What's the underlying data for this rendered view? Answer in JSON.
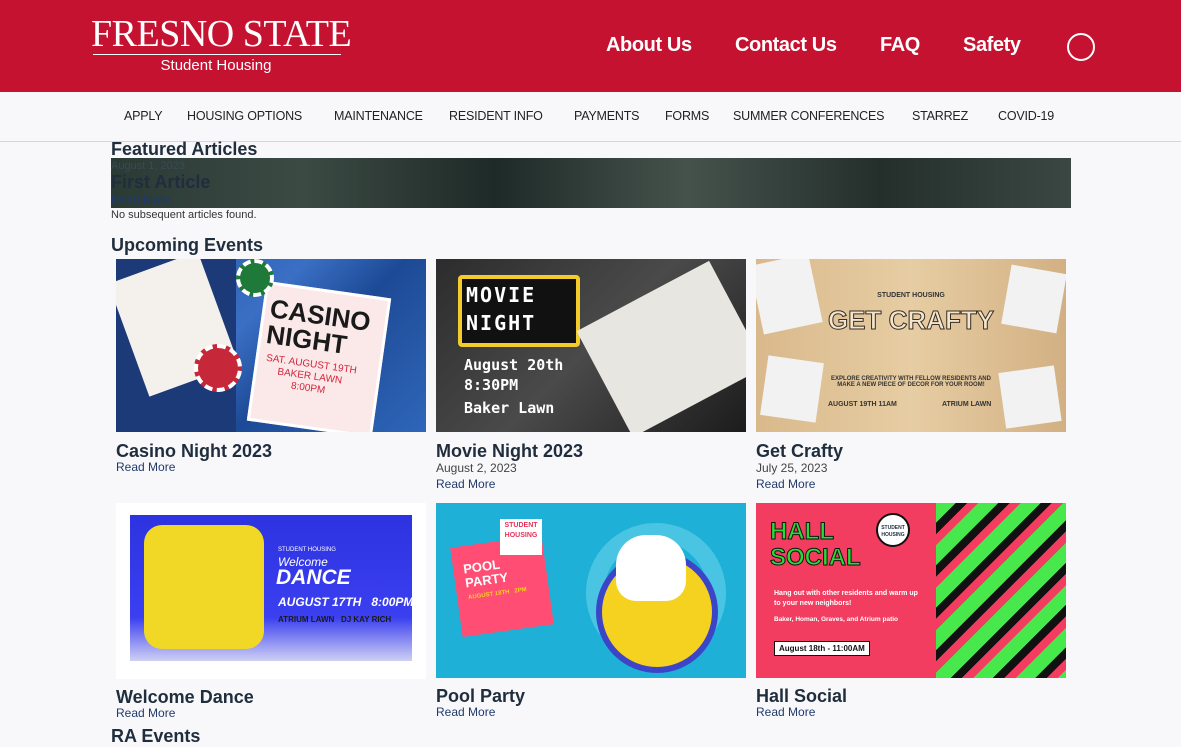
{
  "header": {
    "logo_text": "FRESNO STATE",
    "logo_sub": "Student Housing",
    "nav": [
      "About Us",
      "Contact Us",
      "FAQ",
      "Safety"
    ],
    "search_icon": "search-icon"
  },
  "subnav": [
    "APPLY",
    "HOUSING OPTIONS",
    "MAINTENANCE",
    "RESIDENT INFO",
    "PAYMENTS",
    "FORMS",
    "SUMMER CONFERENCES",
    "STARREZ",
    "COVID-19"
  ],
  "featured": {
    "heading": "Featured Articles",
    "article_title": "First Article",
    "article_date": "August 1, 2023",
    "read_more": "Read More",
    "none_text": "No subsequent articles found."
  },
  "events": {
    "heading": "Upcoming Events",
    "items": [
      {
        "title": "Casino Night 2023",
        "date": "",
        "read_more": "Read More",
        "poster": {
          "line1": "CASINO",
          "line2": "NIGHT",
          "line3": "SAT. AUGUST 19TH",
          "line4": "BAKER LAWN",
          "line5": "8:00PM"
        }
      },
      {
        "title": "Movie Night 2023",
        "date": "August 2, 2023",
        "read_more": "Read More",
        "poster": {
          "line1": "MOVIE",
          "line2": "NIGHT",
          "line3": "August 20th",
          "line4": "8:30PM",
          "line5": "Baker Lawn"
        }
      },
      {
        "title": "Get Crafty",
        "date": "July 25, 2023",
        "read_more": "Read More",
        "poster": {
          "line1": "STUDENT HOUSING",
          "line2": "GET CRAFTY",
          "line3": "EXPLORE CREATIVITY WITH FELLOW RESIDENTS AND MAKE A NEW PIECE OF DECOR FOR YOUR ROOM!",
          "line4": "AUGUST 19TH 11AM",
          "line5": "ATRIUM LAWN"
        }
      },
      {
        "title": "Welcome Dance",
        "date": "",
        "read_more": "Read More",
        "poster": {
          "line1": "STUDENT HOUSING",
          "line2": "Welcome",
          "line3": "DANCE",
          "line4": "AUGUST 17TH   8:00PM",
          "line5": "ATRIUM LAWN   DJ KAY RICH"
        }
      },
      {
        "title": "Pool Party",
        "date": "",
        "read_more": "Read More",
        "poster": {
          "line1": "STUDENT HOUSING",
          "line2": "POOL PARTY",
          "line3": "AUGUST 18TH   2PM"
        }
      },
      {
        "title": "Hall Social",
        "date": "",
        "read_more": "Read More",
        "poster": {
          "line1": "HALL SOCIAL",
          "line2": "Hang out with other residents and warm up to your new neighbors!",
          "line3": "Baker, Homan, Graves, and Atrium patio",
          "line4": "August 18th - 11:00AM",
          "badge": "STUDENT HOUSING"
        }
      }
    ]
  },
  "ra_events": {
    "heading": "RA Events"
  },
  "colors": {
    "brand_red": "#c41230",
    "text_navy": "#1f2d3d",
    "link_blue": "#1f3a6b"
  }
}
